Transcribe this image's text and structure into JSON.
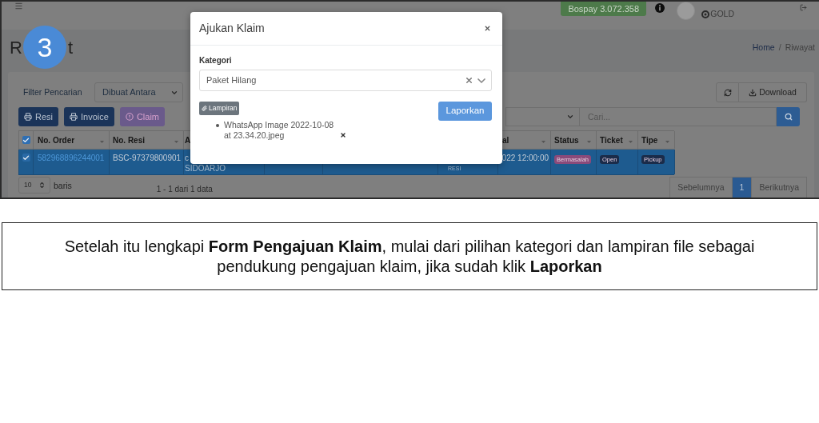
{
  "app_screenshot": {
    "navbar": {
      "balance": "Bospay 3.072.358",
      "user_level": "GOLD"
    },
    "page_title_fragments": [
      "R",
      "t"
    ],
    "breadcrumb": {
      "items": [
        "Home",
        "Riwayat"
      ],
      "separator": "/"
    },
    "filter": {
      "label": "Filter Pencarian",
      "value": "Dibuat Antara"
    },
    "toolbar_buttons": [
      {
        "kind": "refresh"
      },
      {
        "kind": "download",
        "label": "Download"
      }
    ],
    "action_buttons": [
      {
        "kind": "print",
        "label": "Resi"
      },
      {
        "kind": "print",
        "label": "Invoice"
      },
      {
        "kind": "claim",
        "label": "Claim"
      }
    ],
    "search": {
      "placeholder": "Cari..."
    },
    "table": {
      "header_checkbox": {
        "checked": true
      },
      "columns": [
        {
          "kind": "sortable",
          "label": "No. Order"
        },
        {
          "kind": "sortable",
          "label": "No. Resi"
        },
        {
          "kind": "sortable",
          "label": "A"
        },
        {
          "kind": "covered"
        },
        {
          "kind": "covered"
        },
        {
          "kind": "covered"
        },
        {
          "kind": "sortable",
          "label": "al"
        },
        {
          "kind": "sortable",
          "label": "Status"
        },
        {
          "kind": "sortable",
          "label": "Ticket"
        },
        {
          "kind": "sortable",
          "label": "Tipe"
        }
      ],
      "rows": [
        {
          "selected": true,
          "checked": true,
          "cells": [
            {
              "kind": "link",
              "text": "582968896244001"
            },
            {
              "kind": "text",
              "text": "BSC-97379800901"
            },
            {
              "kind": "text",
              "text": "c",
              "subtext": "SIDOARJO"
            },
            {
              "kind": "covered"
            },
            {
              "kind": "covered"
            },
            {
              "kind": "text",
              "subtext": "RESI"
            },
            {
              "kind": "date",
              "text": "022 12:00:00"
            },
            {
              "kind": "badge",
              "text": "Bermasalah",
              "color": "#8a4a7a"
            },
            {
              "kind": "badge",
              "text": "Open",
              "color": "#1b2c4a"
            },
            {
              "kind": "badge",
              "text": "Pickup",
              "color": "#1b2c4a"
            }
          ]
        }
      ]
    },
    "rows_per_page": {
      "value": "10",
      "label": "baris"
    },
    "page_info": "1 - 1 dari 1 data",
    "pagination": [
      {
        "label": "Sebelumnya",
        "selected": false
      },
      {
        "label": "1",
        "selected": true
      },
      {
        "label": "Berikutnya",
        "selected": false
      }
    ]
  },
  "step_badge": "3",
  "modal": {
    "title": "Ajukan Klaim",
    "category": {
      "label": "Kategori",
      "value": "Paket Hilang"
    },
    "attachment": {
      "label": "Lampiran",
      "files": [
        "WhatsApp Image 2022-10-08 at 23.34.20.jpeg"
      ]
    },
    "submit": "Laporkan"
  },
  "caption": "Setelah itu lengkapi **Form Pengajuan Klaim**, mulai dari pilihan kategori dan lampiran file sebagai pendukung pengajuan klaim, jika sudah klik **Laporkan**"
}
